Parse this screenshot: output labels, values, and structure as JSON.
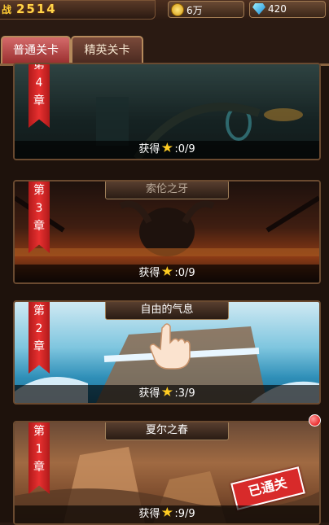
{
  "header": {
    "power_icon": "战",
    "power_value": "2514",
    "coins": "6万",
    "coin_icon": "gold-coin-icon",
    "gems": "420",
    "gem_icon": "diamond-icon"
  },
  "tabs": [
    {
      "label": "普通关卡",
      "active": true
    },
    {
      "label": "精英关卡",
      "active": false
    }
  ],
  "chapters": [
    {
      "ribbon": [
        "第",
        "4",
        "章"
      ],
      "title": "",
      "earned_label": "获得",
      "stars": ":0/9",
      "locked": true
    },
    {
      "ribbon": [
        "第",
        "3",
        "章"
      ],
      "title": "索伦之牙",
      "earned_label": "获得",
      "stars": ":0/9",
      "locked": true
    },
    {
      "ribbon": [
        "第",
        "2",
        "章"
      ],
      "title": "自由的气息",
      "earned_label": "获得",
      "stars": ":3/9",
      "locked": false
    },
    {
      "ribbon": [
        "第",
        "1",
        "章"
      ],
      "title": "夏尔之春",
      "earned_label": "获得",
      "stars": ":9/9",
      "locked": false,
      "stamp": "已通关"
    }
  ],
  "colors": {
    "ribbon": "#e83030",
    "star": "#ffcc22",
    "accent": "#ffd54a"
  }
}
